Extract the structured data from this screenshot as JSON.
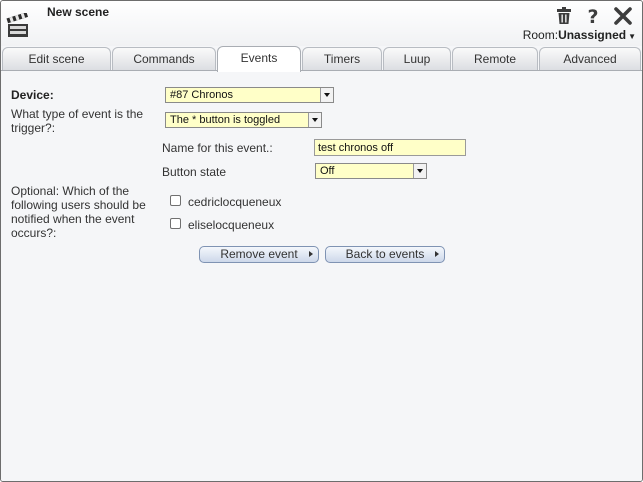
{
  "header": {
    "title": "New scene",
    "room_label": "Room:",
    "room_value": "Unassigned",
    "icons": [
      "clapperboard-icon",
      "trash-icon",
      "help-icon",
      "close-icon"
    ]
  },
  "tabs": [
    {
      "label": "Edit scene",
      "active": false
    },
    {
      "label": "Commands",
      "active": false
    },
    {
      "label": "Events",
      "active": true
    },
    {
      "label": "Timers",
      "active": false
    },
    {
      "label": "Luup",
      "active": false
    },
    {
      "label": "Remote",
      "active": false
    },
    {
      "label": "Advanced",
      "active": false
    }
  ],
  "form": {
    "device_label": "Device:",
    "device_value": "#87 Chronos",
    "trigger_label": "What type of event is the trigger?:",
    "trigger_value": "The * button is toggled",
    "name_label": "Name for this event.:",
    "name_value": "test chronos off",
    "button_state_label": "Button state",
    "button_state_value": "Off",
    "notify_label": "Optional: Which of the following users should be notified when the event occurs?:",
    "users": [
      {
        "name": "cedriclocqueneux",
        "checked": false
      },
      {
        "name": "eliselocqueneux",
        "checked": false
      }
    ]
  },
  "actions": {
    "remove_label": "Remove event",
    "back_label": "Back to events"
  },
  "colors": {
    "field_bg": "#ffffc8",
    "button_gradient_bottom": "#cdd8ea",
    "panel_bg": "#f5f6f8"
  }
}
